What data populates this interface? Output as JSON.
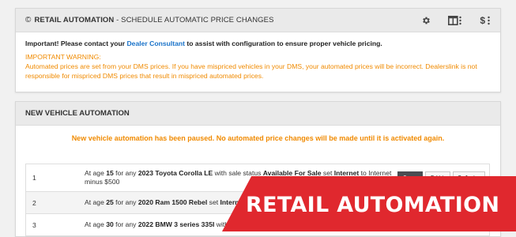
{
  "top_panel": {
    "copyright_symbol": "©",
    "title_bold": "RETAIL AUTOMATION",
    "title_rest": " - SCHEDULE AUTOMATIC PRICE CHANGES",
    "icons": [
      "gear-icon",
      "columns-icon",
      "dollar-icon"
    ],
    "dollar_label": "$",
    "important_prefix": "Important! Please contact your ",
    "dealer_link": "Dealer Consultant",
    "important_suffix": " to assist with configuration to ensure proper vehicle pricing.",
    "warning_title": "IMPORTANT WARNING:",
    "warning_text": "Automated prices are set from your DMS prices. If you have mispriced vehicles in your DMS, your automated prices will be incorrect. Dealerslink is not responsible for mispriced DMS prices that result in mispriced automated prices."
  },
  "nva_panel": {
    "title": "NEW VEHICLE AUTOMATION",
    "paused_message": "New vehicle automation has been paused. No automated price changes will be made until it is activated again.",
    "rules": [
      {
        "num": "1",
        "p1": "At age ",
        "age": "15",
        "p2": " for any ",
        "vehicle": "2023 Toyota Corolla LE",
        "p3": " with sale status ",
        "status": "Available For Sale",
        "p4": " set ",
        "field": "Internet",
        "p5": " to Internet minus $500"
      },
      {
        "num": "2",
        "p1": "At age ",
        "age": "25",
        "p2": " for any ",
        "vehicle": "2020 Ram 1500 Rebel",
        "p3": " set ",
        "field": "Internet",
        "p4": " to"
      },
      {
        "num": "3",
        "p1": "At age ",
        "age": "30",
        "p2": " for any ",
        "vehicle": "2022 BMW 3 series 335I",
        "p3": " with sale"
      }
    ],
    "buttons": {
      "copy": "Copy",
      "edit": "Edit",
      "delete": "Delete"
    }
  },
  "banner": {
    "text": "RETAIL AUTOMATION",
    "color": "#e0282e"
  },
  "colors": {
    "warning": "#f08a00",
    "link": "#1a73c9",
    "header_bg": "#eaeaea"
  }
}
